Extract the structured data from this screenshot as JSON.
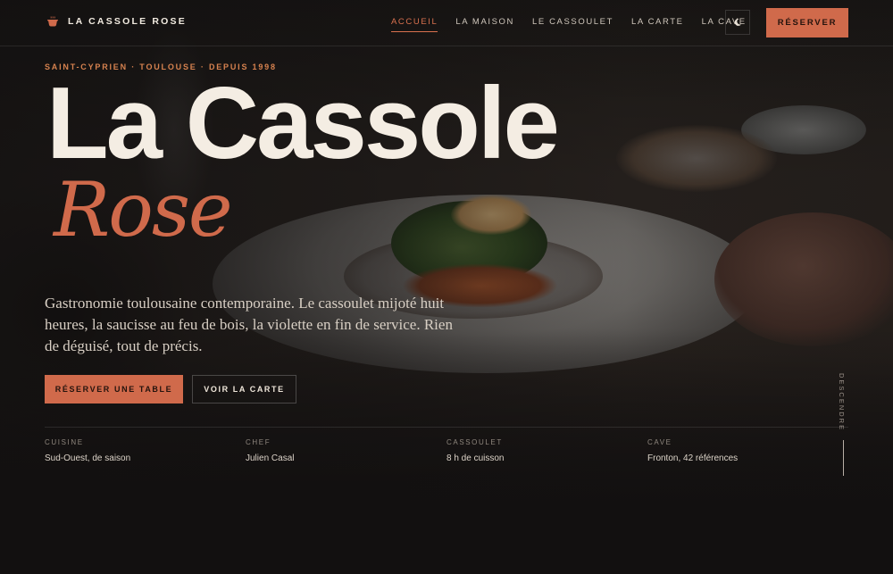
{
  "header": {
    "brand_name": "LA CASSOLE ROSE",
    "nav": [
      {
        "label": "ACCUEIL",
        "active": true
      },
      {
        "label": "LA MAISON",
        "active": false
      },
      {
        "label": "LE CASSOULET",
        "active": false
      },
      {
        "label": "LA CARTE",
        "active": false
      },
      {
        "label": "LA CAVE",
        "active": false
      }
    ],
    "theme_toggle_icon": "moon-icon",
    "reserve_label": "RÉSERVER"
  },
  "hero": {
    "eyebrow": "SAINT-CYPRIEN · TOULOUSE · DEPUIS 1998",
    "title_line1": "La Cassole",
    "title_line2": "Rose",
    "lede": "Gastronomie toulousaine contemporaine. Le cassoulet mijoté huit heures, la saucisse au feu de bois, la violette en fin de service. Rien de déguisé, tout de précis.",
    "primary_cta": "RÉSERVER UNE TABLE",
    "secondary_cta": "VOIR LA CARTE"
  },
  "facts": [
    {
      "label": "CUISINE",
      "value": "Sud-Ouest, de saison"
    },
    {
      "label": "CHEF",
      "value": "Julien Casal"
    },
    {
      "label": "CASSOULET",
      "value": "8 h de cuisson"
    },
    {
      "label": "CAVE",
      "value": "Fronton, 42 références"
    }
  ],
  "scroll_cue": "DESCENDRE",
  "colors": {
    "accent": "#d06a4b",
    "background": "#121010",
    "text": "#f4ede3"
  }
}
